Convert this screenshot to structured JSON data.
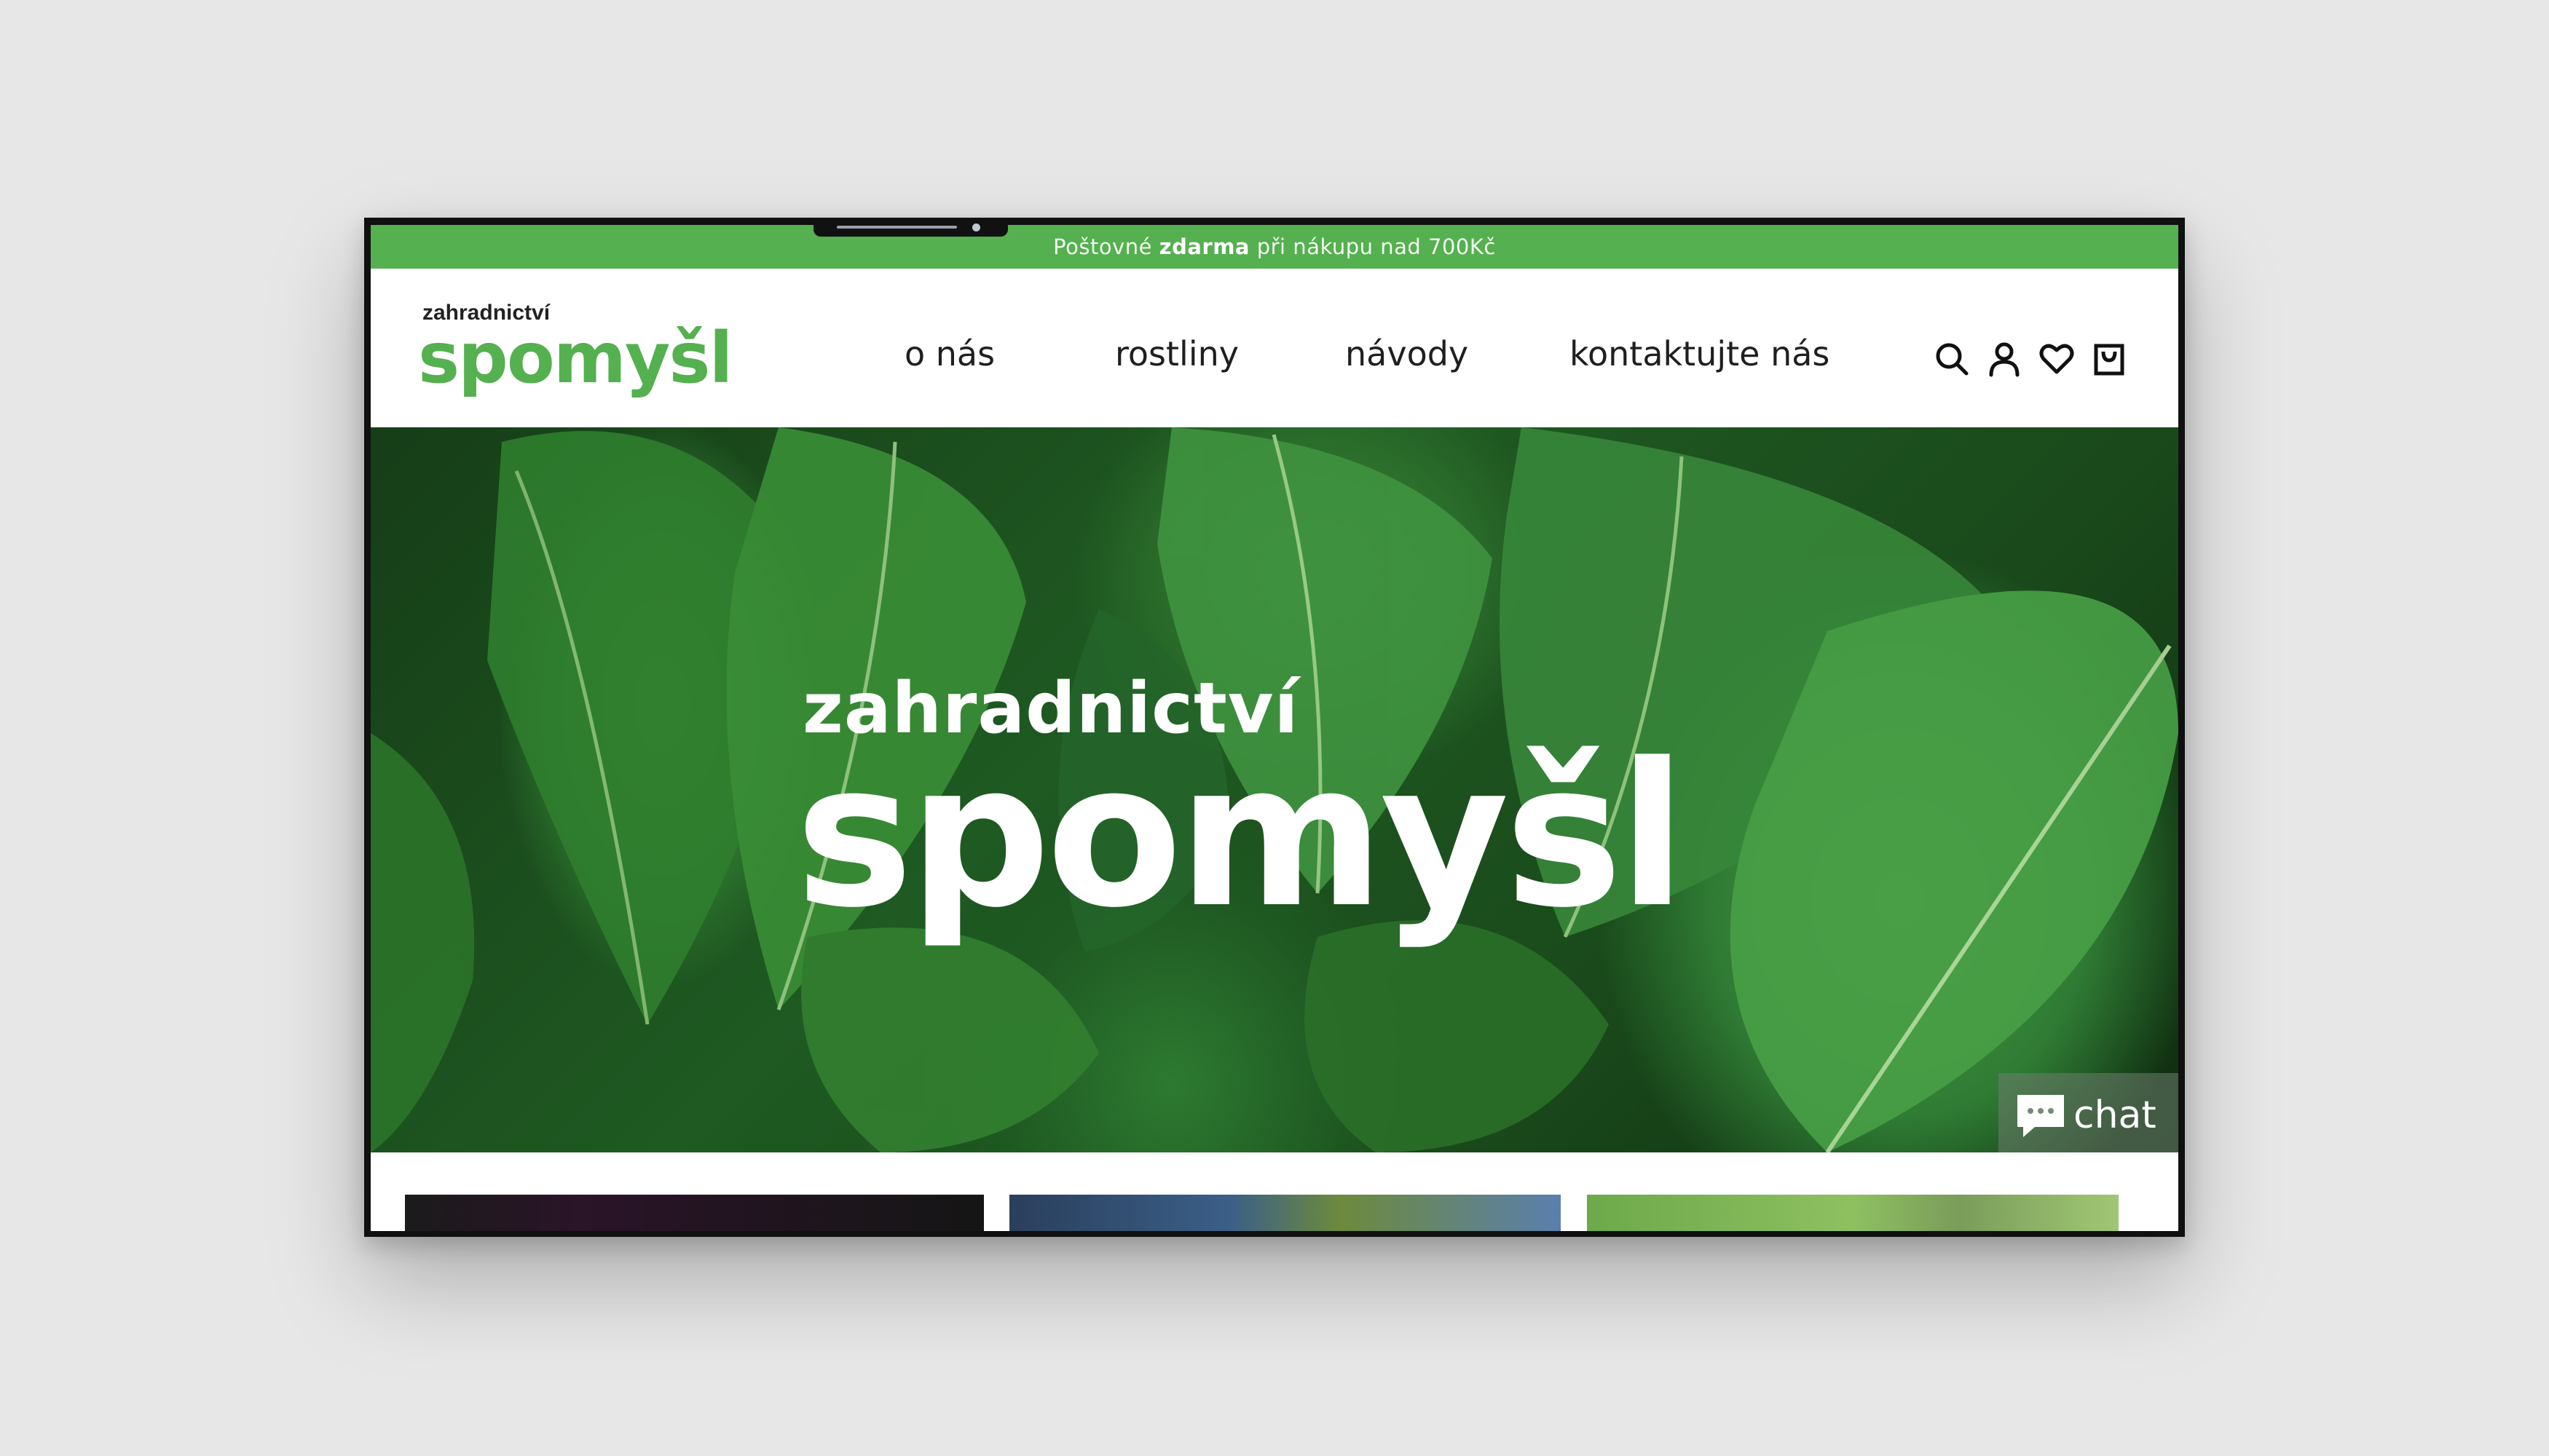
{
  "promo": {
    "prefix": "Poštovné",
    "highlight": "zdarma",
    "suffix": "při nákupu nad 700Kč"
  },
  "logo": {
    "small": "zahradnictví",
    "big": "spomyšl"
  },
  "nav": {
    "items": [
      {
        "label": "o nás"
      },
      {
        "label": "rostliny"
      },
      {
        "label": "návody"
      },
      {
        "label": "kontaktujte nás"
      }
    ]
  },
  "header_icons": [
    "search-icon",
    "user-icon",
    "heart-icon",
    "bag-icon"
  ],
  "hero": {
    "small": "zahradnictví",
    "big": "spomyšl"
  },
  "chat": {
    "label": "chat"
  },
  "colors": {
    "brand_green": "#55b04f",
    "page_bg": "#e7e7e7",
    "text_dark": "#1f1f1f"
  }
}
